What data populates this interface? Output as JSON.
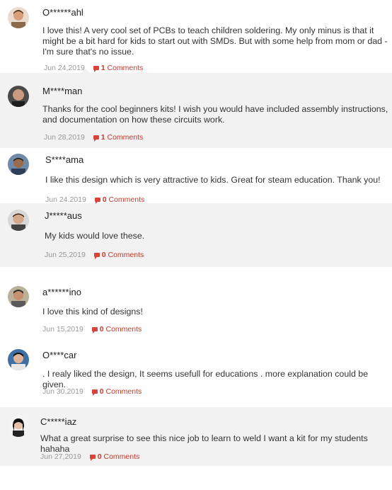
{
  "comments": [
    {
      "user": "O******ahl",
      "text": "I love this! A very cool set of PCBs to teach children soldering. My only minus is that it might be a bit hard for kids to start out with SMDs. But with some help from mom or dad - I'm sure that's no issue.",
      "date": "Jun 24,2019",
      "count": "1",
      "count_label": "Comments"
    },
    {
      "user": "M****man",
      "text": "Thanks for the cool beginners kits! I wish you would have included assembly instructions, and documentation on how these circuits work.",
      "date": "Jun 28,2019",
      "count": "1",
      "count_label": "Comments"
    },
    {
      "user": "S****ama",
      "text": "I like this design which is very attractive to kids. Great for steam education. Thank you!",
      "date": "Jun 24.2019",
      "count": "0",
      "count_label": "Comments"
    },
    {
      "user": "J*****aus",
      "text": "My kids would love these.",
      "date": "Jun 25,2019",
      "count": "0",
      "count_label": "Comments"
    },
    {
      "user": "a******ino",
      "text": "I love this kind of designs!",
      "date": "Jun 15,2019",
      "count": "0",
      "count_label": "Comments"
    },
    {
      "user": "O****car",
      "text": ". I realy liked the design, It seems usefull for educations . more explanation could be given.",
      "date": "Jun 30,2019",
      "count": "0",
      "count_label": "Comments"
    },
    {
      "user": "C*****iaz",
      "text": "What a great surprise to see this nice job to learn to weld I want a kit for my students hahaha",
      "date": "Jun 27,2019",
      "count": "0",
      "count_label": "Comments"
    }
  ],
  "colors": {
    "band": "#f2f2f2",
    "comment_link": "#c7392e",
    "date": "#999999"
  }
}
